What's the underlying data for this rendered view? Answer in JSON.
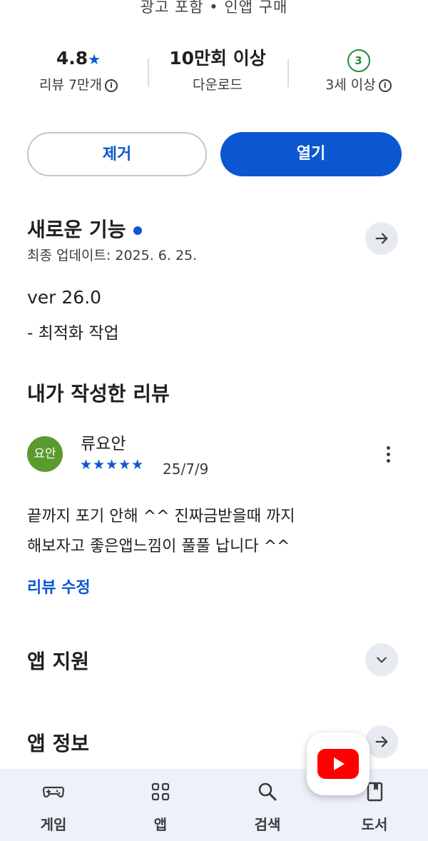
{
  "top_notice": "광고 포함 • 인앱 구매",
  "stats": {
    "rating_value": "4.8",
    "rating_label": "리뷰 7만개",
    "downloads_value": "10만회 이상",
    "downloads_label": "다운로드",
    "age_badge": "3",
    "age_label": "3세 이상"
  },
  "buttons": {
    "remove": "제거",
    "open": "열기"
  },
  "whats_new": {
    "title": "새로운 기능",
    "updated": "최종 업데이트: 2025. 6. 25.",
    "version": "ver 26.0",
    "note": "- 최적화 작업"
  },
  "my_review": {
    "title": "내가 작성한 리뷰",
    "avatar_text": "요안",
    "author": "류요안",
    "stars": 5,
    "stars_text": "★★★★★",
    "date": "25/7/9",
    "line1": "끝까지 포기 안해 ^^ 진짜금받을때 까지",
    "line2": "해보자고 좋은앱느낌이 풀풀 납니다 ^^",
    "edit_link": "리뷰 수정"
  },
  "sections": {
    "app_support": "앱 지원",
    "app_info": "앱 정보"
  },
  "nav": [
    {
      "label": "게임",
      "icon": "gamepad-icon"
    },
    {
      "label": "앱",
      "icon": "apps-grid-icon"
    },
    {
      "label": "검색",
      "icon": "search-icon"
    },
    {
      "label": "도서",
      "icon": "book-icon"
    }
  ],
  "colors": {
    "accent": "#0b57d0",
    "avatar": "#5b9a2e",
    "age_green": "#1e8e3e",
    "youtube_red": "#ff0000"
  }
}
